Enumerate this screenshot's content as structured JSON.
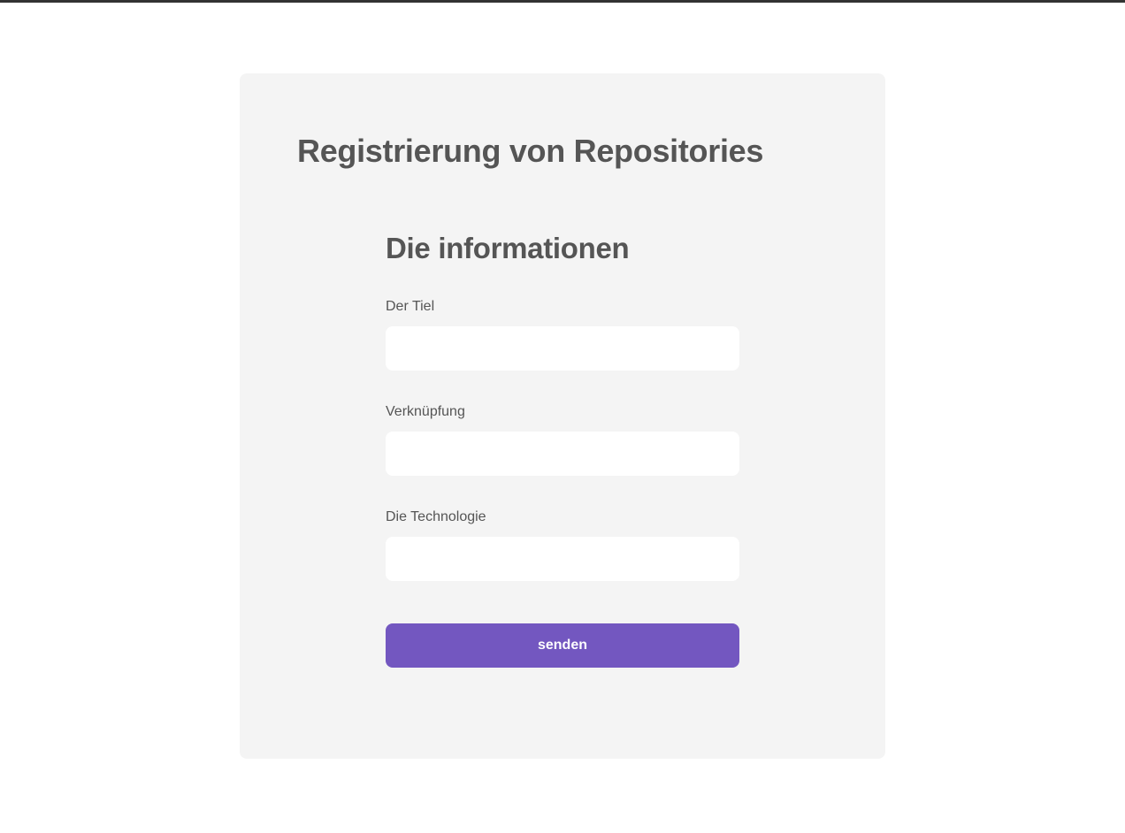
{
  "page": {
    "title": "Registrierung von Repositories"
  },
  "form": {
    "section_title": "Die informationen",
    "fields": [
      {
        "label": "Der Tiel",
        "value": "",
        "placeholder": ""
      },
      {
        "label": "Verknüpfung",
        "value": "",
        "placeholder": ""
      },
      {
        "label": "Die Technologie",
        "value": "",
        "placeholder": ""
      }
    ],
    "submit_label": "senden"
  },
  "colors": {
    "card_background": "#f4f4f4",
    "text": "#555555",
    "button_accent": "#7357c0",
    "top_border": "#333333"
  }
}
